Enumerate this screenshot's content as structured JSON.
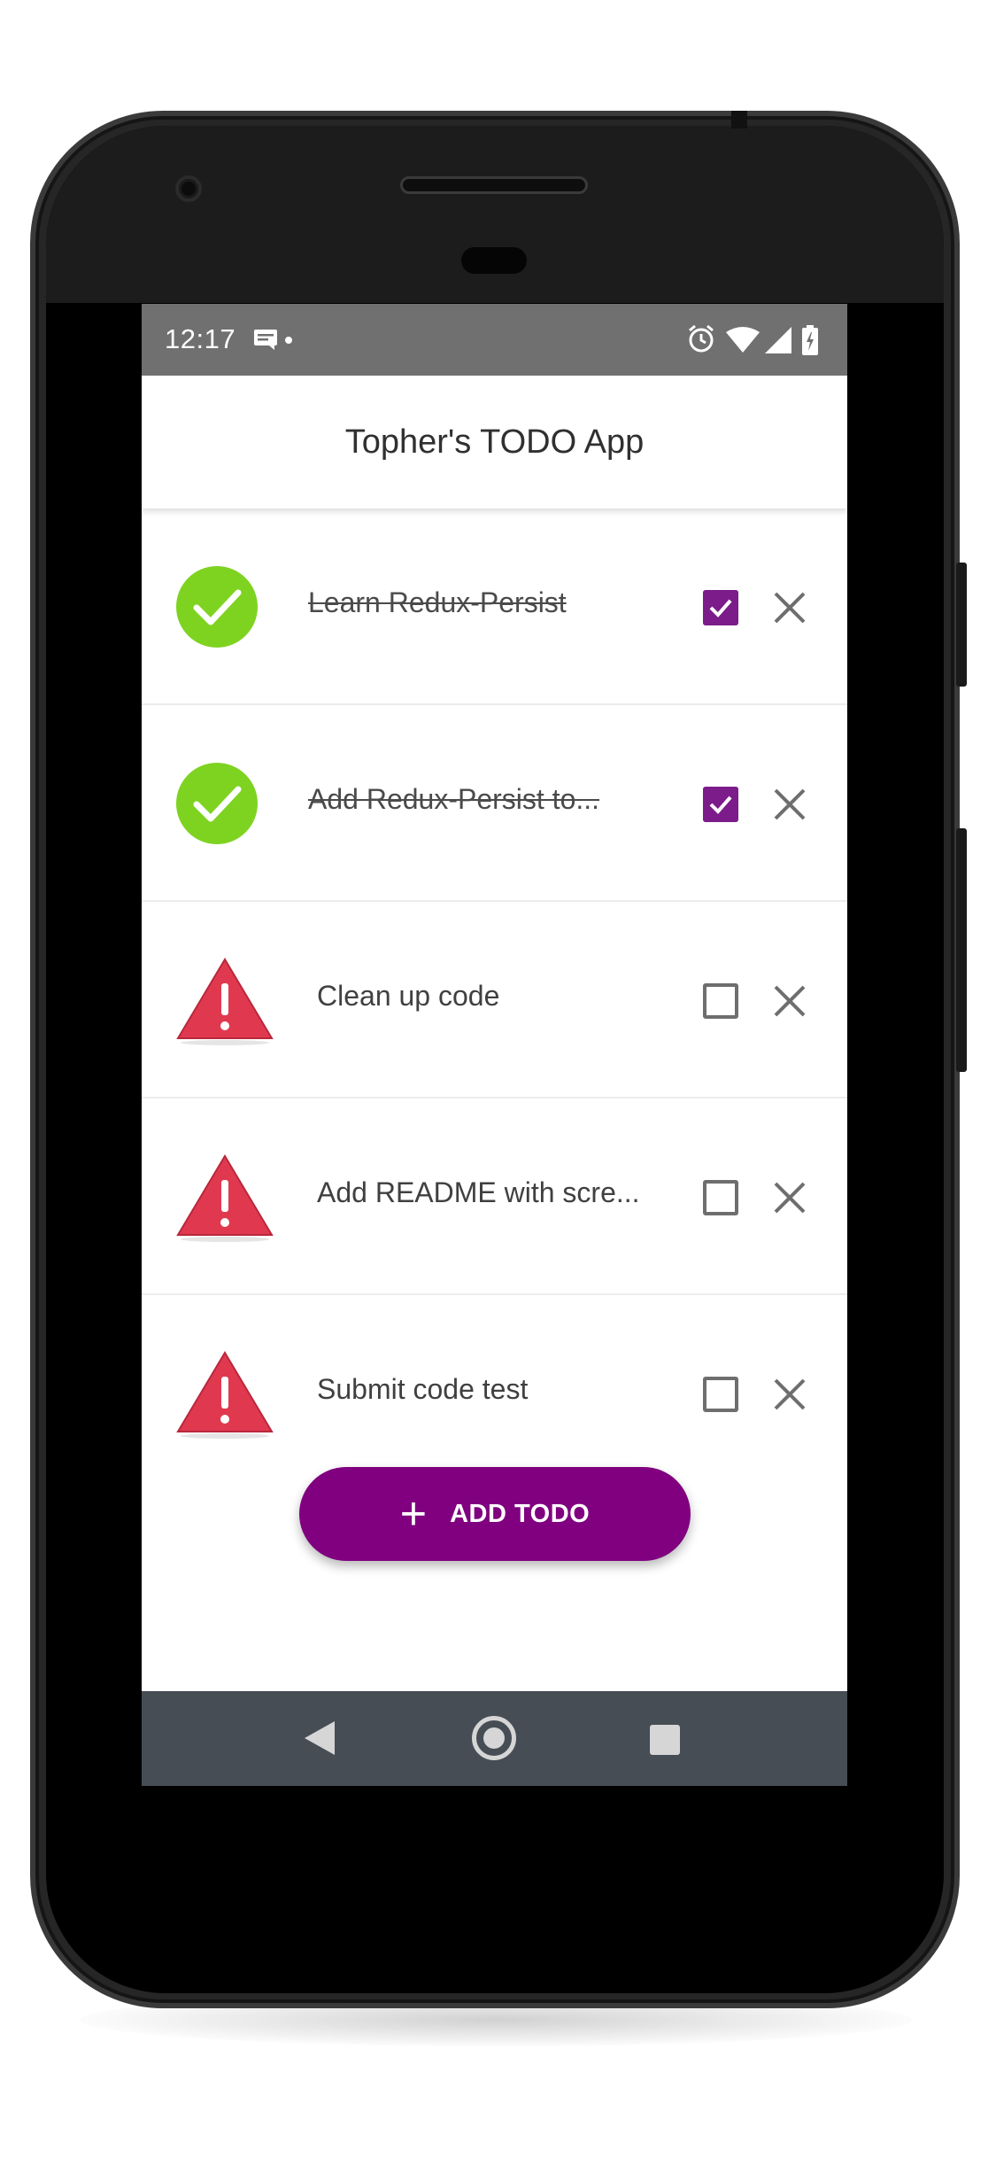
{
  "status_bar": {
    "time": "12:17",
    "icons": [
      "message-notification-icon",
      "notification-dot",
      "alarm-icon",
      "wifi-icon",
      "cellular-signal-icon",
      "battery-charging-icon"
    ]
  },
  "app": {
    "title": "Topher's TODO App"
  },
  "todos": [
    {
      "text": "Learn Redux-Persist",
      "completed": true,
      "status_icon": "check-circle-icon"
    },
    {
      "text": "Add Redux-Persist to...",
      "completed": true,
      "status_icon": "check-circle-icon"
    },
    {
      "text": "Clean up code",
      "completed": false,
      "status_icon": "warning-triangle-icon"
    },
    {
      "text": "Add README with scre...",
      "completed": false,
      "status_icon": "warning-triangle-icon"
    },
    {
      "text": "Submit code test",
      "completed": false,
      "status_icon": "warning-triangle-icon"
    }
  ],
  "add_button": {
    "plus": "+",
    "label": "ADD TODO"
  },
  "nav_bar": {
    "buttons": [
      "back-icon",
      "home-icon",
      "recents-icon"
    ]
  },
  "colors": {
    "accent_purple": "#80007f",
    "checkbox_purple": "#7b1c8a",
    "done_green": "#7ed321",
    "warning_red": "#e0394f",
    "status_bar_gray": "#707070",
    "nav_bar_gray": "#474d54"
  }
}
